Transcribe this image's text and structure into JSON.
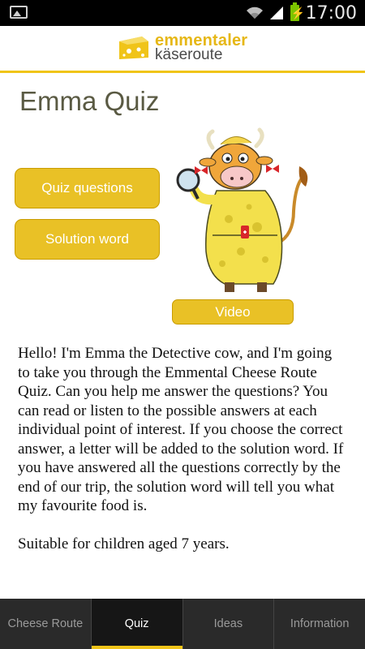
{
  "status_bar": {
    "time": "17:00",
    "battery_icon": "battery-charging-icon",
    "signal_icon": "signal-icon",
    "wifi_icon": "wifi-icon"
  },
  "header": {
    "logo_line1": "emmentaler",
    "logo_line2": "käseroute",
    "accent": "#f0c419"
  },
  "page": {
    "title": "Emma Quiz"
  },
  "buttons": {
    "quiz_questions": "Quiz questions",
    "solution_word": "Solution word",
    "video": "Video"
  },
  "body": {
    "paragraph1": "Hello! I'm Emma the Detective cow, and I'm going to take you through the Emmental Cheese Route Quiz. Can you help me answer the questions? You can read or listen to the possible answers at each individual point of interest. If you choose the correct answer, a letter will be added to the solution word. If you have answered all the questions correctly by the end of our trip, the solution word will tell you what my favourite food is.",
    "paragraph2": "Suitable for children aged 7 years."
  },
  "tabs": [
    {
      "label": "Cheese Route",
      "active": false
    },
    {
      "label": "Quiz",
      "active": true
    },
    {
      "label": "Ideas",
      "active": false
    },
    {
      "label": "Information",
      "active": false
    }
  ]
}
